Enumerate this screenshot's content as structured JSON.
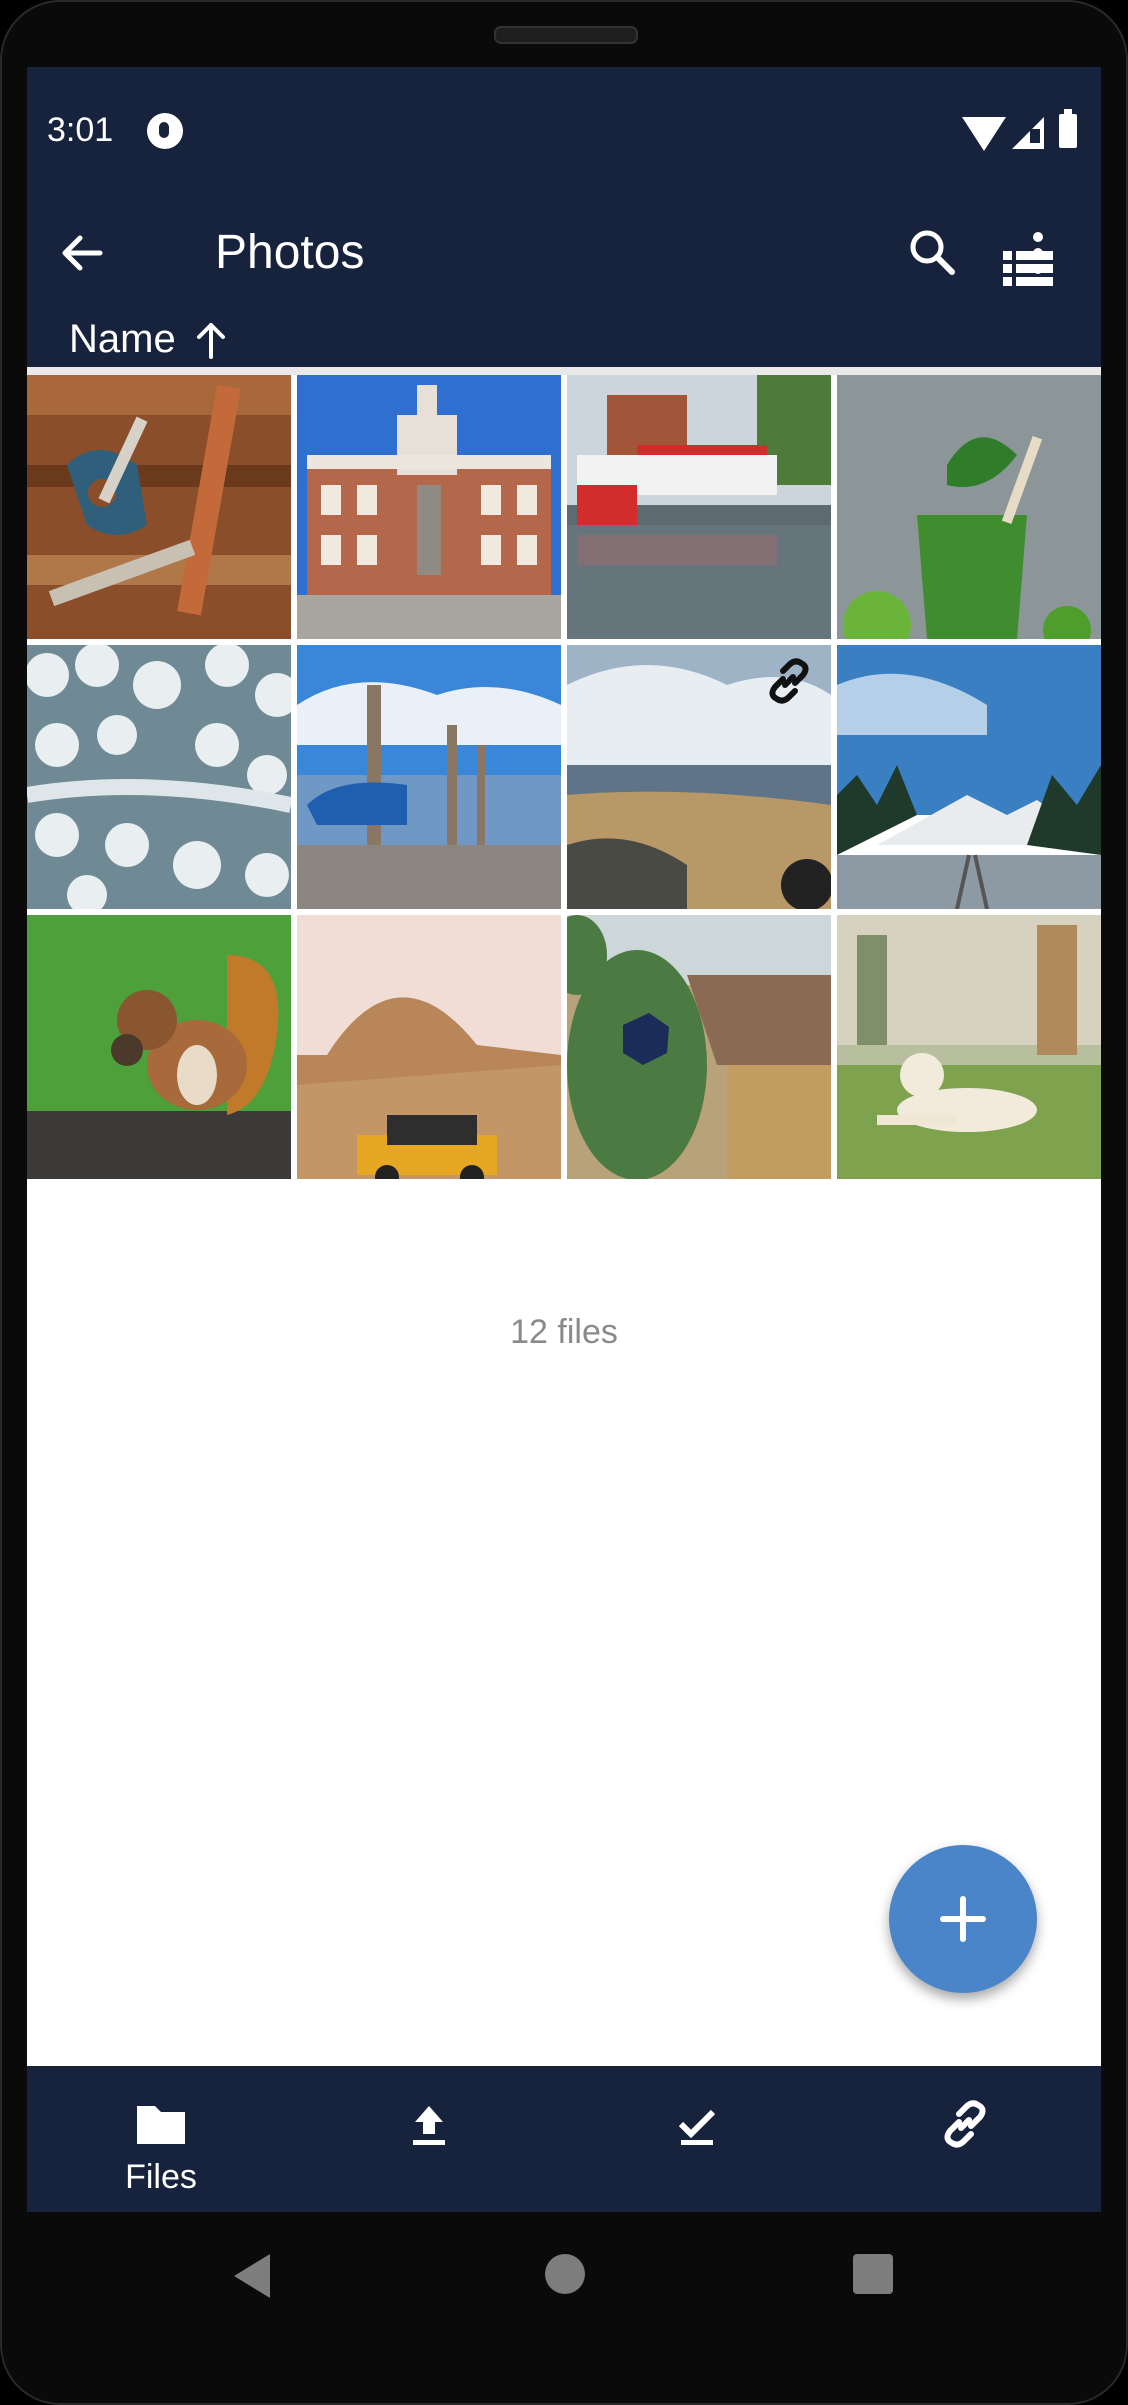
{
  "status_bar": {
    "time": "3:01"
  },
  "toolbar": {
    "title": "Photos"
  },
  "sort": {
    "label": "Name"
  },
  "photos": [
    {
      "subject": "tools"
    },
    {
      "subject": "city-hall"
    },
    {
      "subject": "riverboat"
    },
    {
      "subject": "green-smoothie"
    },
    {
      "subject": "snowy-forest"
    },
    {
      "subject": "boat-on-lake"
    },
    {
      "subject": "beach",
      "shared": true
    },
    {
      "subject": "mountains-railway"
    },
    {
      "subject": "squirrel"
    },
    {
      "subject": "desert-jeep"
    },
    {
      "subject": "cactus"
    },
    {
      "subject": "dog-on-grass"
    }
  ],
  "footer": {
    "file_count": "12 files"
  },
  "bottom_nav": {
    "files_label": "Files"
  },
  "colors": {
    "toolbar": "#17223d",
    "fab": "#4a84c9",
    "divider": "#e9e9e9",
    "muted_text": "#8a8a8a"
  }
}
